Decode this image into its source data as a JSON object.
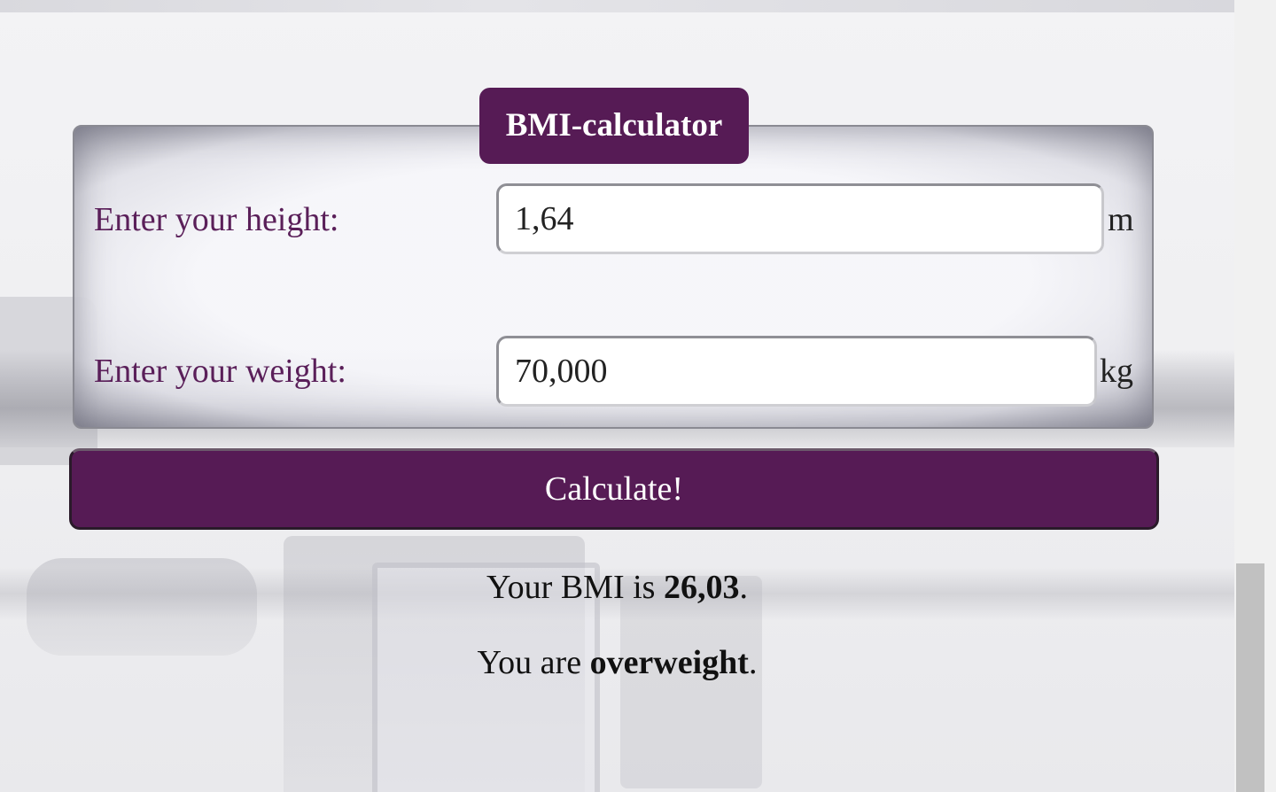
{
  "calculator": {
    "title": "BMI-calculator",
    "height": {
      "label": "Enter your height:",
      "value": "1,64",
      "unit": "m"
    },
    "weight": {
      "label": "Enter your weight:",
      "value": "70,000",
      "unit": "kg"
    },
    "button_label": "Calculate!"
  },
  "result": {
    "bmi_prefix": "Your BMI is ",
    "bmi_value": "26,03",
    "bmi_suffix": ".",
    "category_prefix": "You are ",
    "category_value": "overweight",
    "category_suffix": "."
  },
  "colors": {
    "accent": "#561b55",
    "label": "#5a1f59"
  }
}
